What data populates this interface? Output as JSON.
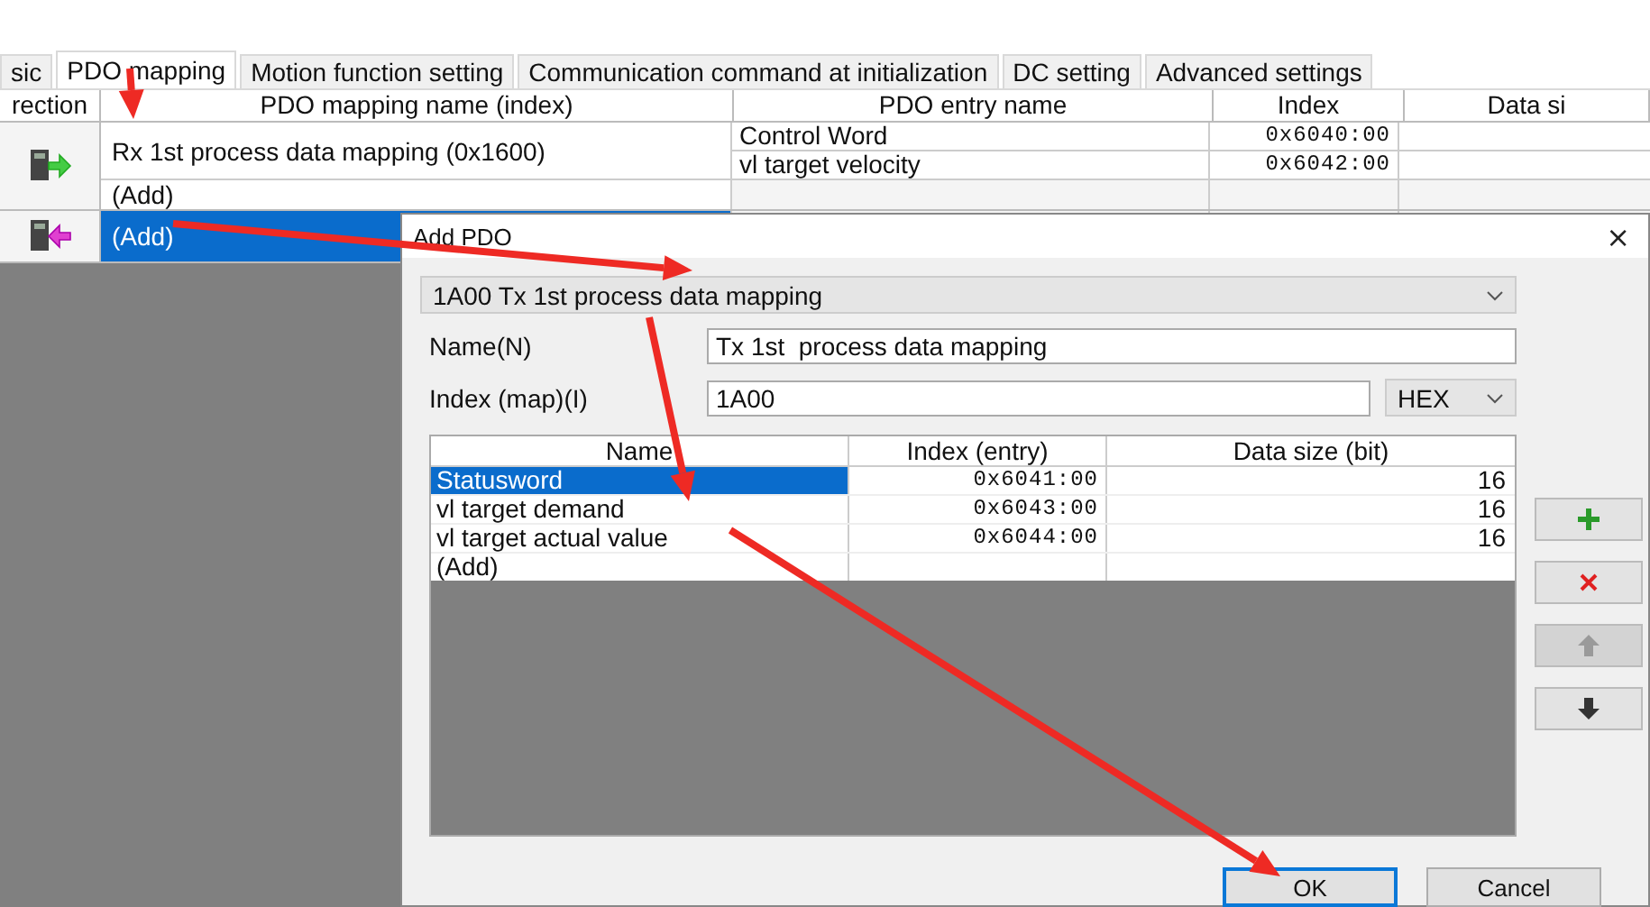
{
  "tabs": [
    {
      "label": "sic",
      "selected": false
    },
    {
      "label": "PDO mapping",
      "selected": true
    },
    {
      "label": "Motion function setting",
      "selected": false
    },
    {
      "label": "Communication command at initialization",
      "selected": false
    },
    {
      "label": "DC setting",
      "selected": false
    },
    {
      "label": "Advanced settings",
      "selected": false
    }
  ],
  "mapping_table": {
    "columns": [
      "rection",
      "PDO mapping name (index)",
      "PDO entry name",
      "Index",
      "Data si"
    ],
    "sections": [
      {
        "kind": "rx",
        "rows": [
          {
            "name": "Rx 1st process data mapping (0x1600)",
            "selected": false,
            "entries": [
              {
                "name": "Control Word",
                "index": "0x6040:00"
              },
              {
                "name": "vl target velocity",
                "index": "0x6042:00"
              }
            ]
          },
          {
            "name": "(Add)",
            "selected": false
          }
        ]
      },
      {
        "kind": "tx",
        "rows": [
          {
            "name": "(Add)",
            "selected": true
          }
        ]
      }
    ]
  },
  "dialog": {
    "title": "Add PDO",
    "close": "×",
    "pdo_select": "1A00 Tx 1st  process data mapping",
    "name_field": {
      "label": "Name(N)",
      "value": "Tx 1st  process data mapping"
    },
    "index_field": {
      "label": "Index (map)(I)",
      "value": "1A00",
      "format": "HEX"
    },
    "entries_table": {
      "columns": [
        "Name",
        "Index (entry)",
        "Data size (bit)"
      ],
      "rows": [
        {
          "name": "Statusword",
          "index": "0x6041:00",
          "size": "16",
          "selected": true
        },
        {
          "name": "vl target demand",
          "index": "0x6043:00",
          "size": "16",
          "selected": false
        },
        {
          "name": "vl target actual value",
          "index": "0x6044:00",
          "size": "16",
          "selected": false
        },
        {
          "name": "(Add)",
          "selected": false
        }
      ]
    },
    "side_buttons": [
      {
        "kind": "add",
        "disabled": false
      },
      {
        "kind": "remove",
        "disabled": false
      },
      {
        "kind": "up",
        "disabled": true
      },
      {
        "kind": "down",
        "disabled": false
      }
    ],
    "buttons": [
      {
        "label": "OK",
        "default": true
      },
      {
        "label": "Cancel",
        "default": false
      }
    ]
  }
}
